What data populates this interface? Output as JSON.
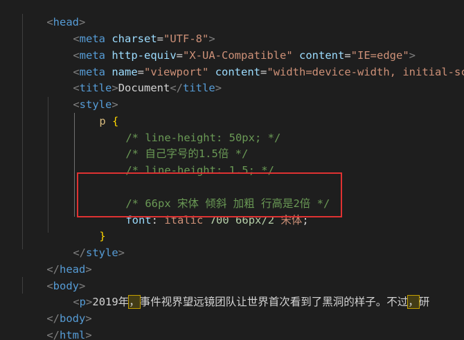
{
  "code": {
    "l1": {
      "open": "<",
      "tag": "head",
      "close": ">"
    },
    "l2": {
      "open": "<",
      "tag": "meta",
      "a1": "charset",
      "eq1": "=",
      "v1": "\"UTF-8\"",
      "close": ">"
    },
    "l3": {
      "open": "<",
      "tag": "meta",
      "a1": "http-equiv",
      "eq1": "=",
      "v1": "\"X-UA-Compatible\"",
      "a2": "content",
      "eq2": "=",
      "v2": "\"IE=edge\"",
      "close": ">"
    },
    "l4": {
      "open": "<",
      "tag": "meta",
      "a1": "name",
      "eq1": "=",
      "v1": "\"viewport\"",
      "a2": "content",
      "eq2": "=",
      "v2": "\"width=device-width, initial-sca"
    },
    "l5": {
      "open": "<",
      "tag": "title",
      "close1": ">",
      "text": "Document",
      "open2": "</",
      "tag2": "title",
      "close": ">"
    },
    "l6": {
      "open": "<",
      "tag": "style",
      "close": ">"
    },
    "l7": {
      "sel": "p",
      "brace": "{"
    },
    "l8": {
      "comment": "/* line-height: 50px; */"
    },
    "l9": {
      "comment": "/* 自己字号的1.5倍 */"
    },
    "l10": {
      "comment": "/* line-height: 1.5; */"
    },
    "l12": {
      "comment": "/* 66px 宋体 倾斜 加粗 行高是2倍 */"
    },
    "l13": {
      "prop": "font",
      "colon": ":",
      "v1": "italic",
      "v2": "700",
      "v3": "66px/2",
      "v4": "宋体",
      "semi": ";"
    },
    "l14": {
      "brace": "}"
    },
    "l15": {
      "open": "</",
      "tag": "style",
      "close": ">"
    },
    "l16": {
      "open": "</",
      "tag": "head",
      "close": ">"
    },
    "l17": {
      "open": "<",
      "tag": "body",
      "close": ">"
    },
    "l18": {
      "open": "<",
      "tag": "p",
      "close": ">",
      "text1": "2019年",
      "comma1": "，",
      "text2": "事件视界望远镜团队让世界首次看到了黑洞的样子。不过",
      "comma2": "，",
      "text3": "研"
    },
    "l19": {
      "open": "</",
      "tag": "body",
      "close": ">"
    },
    "l20": {
      "open": "</",
      "tag": "html",
      "close": ">"
    }
  },
  "colors": {
    "background": "#1e1e1e",
    "tag": "#569cd6",
    "attribute": "#9cdcfe",
    "string": "#ce9178",
    "comment": "#6a9955",
    "selector": "#d7ba7d",
    "bracket": "#ffd700",
    "number": "#b5cea8",
    "highlight_border": "#e03232"
  }
}
